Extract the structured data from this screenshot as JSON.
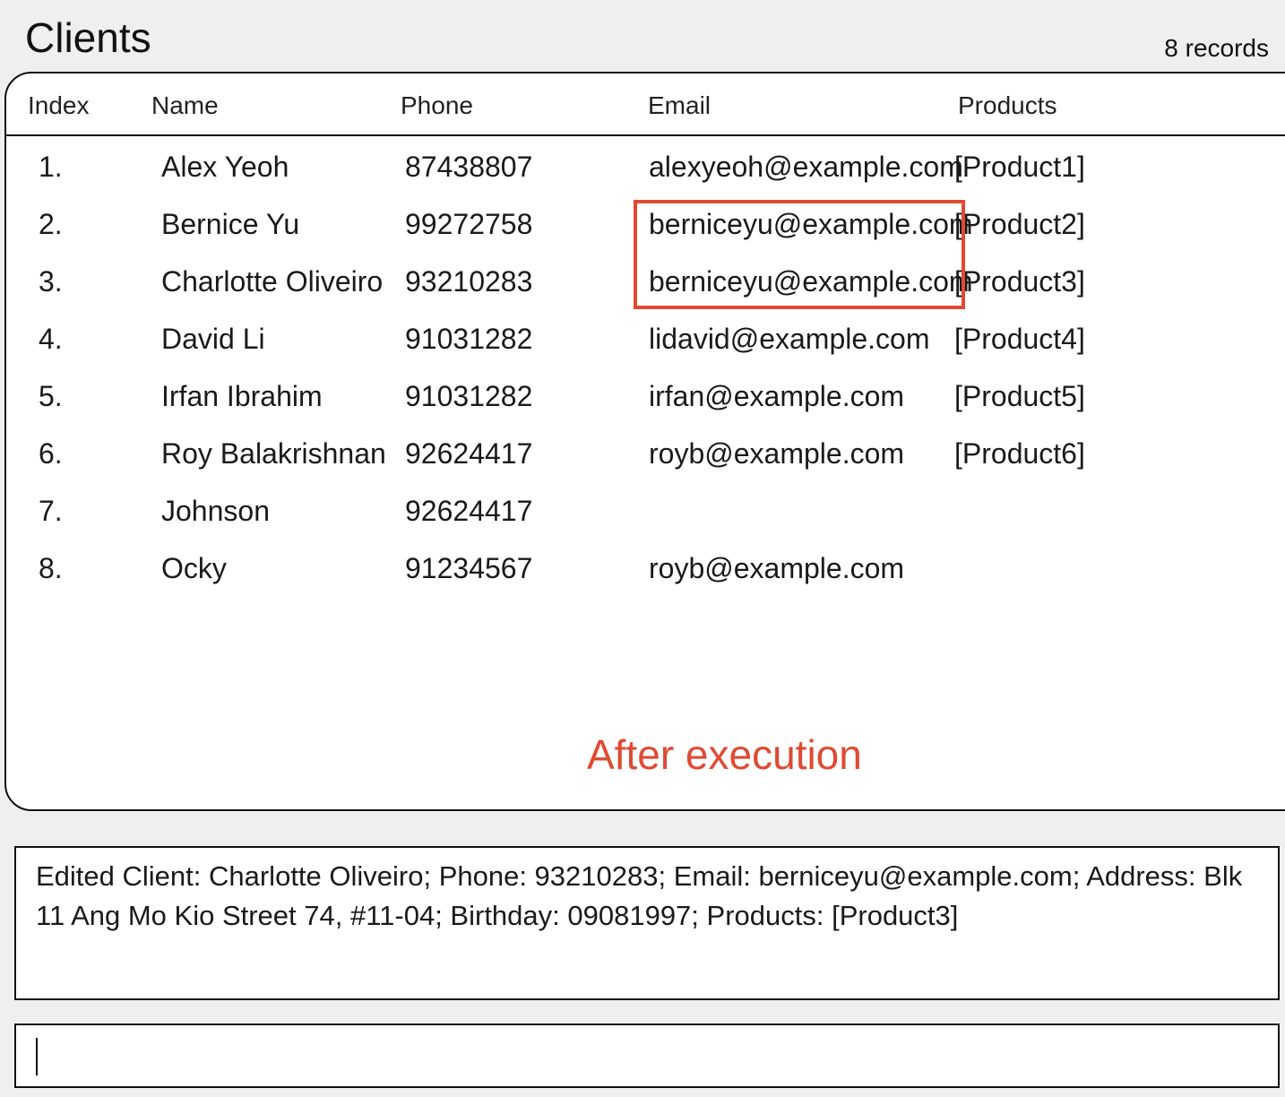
{
  "title": "Clients",
  "record_count": "8 records",
  "table": {
    "columns": [
      "Index",
      "Name",
      "Phone",
      "Email",
      "Products"
    ],
    "rows": [
      {
        "index": "1.",
        "name": "Alex Yeoh",
        "phone": "87438807",
        "email": "alexyeoh@example.com",
        "products": "[Product1]"
      },
      {
        "index": "2.",
        "name": "Bernice Yu",
        "phone": "99272758",
        "email": "berniceyu@example.com",
        "products": "[Product2]"
      },
      {
        "index": "3.",
        "name": "Charlotte Oliveiro",
        "phone": "93210283",
        "email": "berniceyu@example.com",
        "products": "[Product3]"
      },
      {
        "index": "4.",
        "name": "David Li",
        "phone": "91031282",
        "email": "lidavid@example.com",
        "products": "[Product4]"
      },
      {
        "index": "5.",
        "name": "Irfan Ibrahim",
        "phone": "91031282",
        "email": "irfan@example.com",
        "products": "[Product5]"
      },
      {
        "index": "6.",
        "name": "Roy Balakrishnan",
        "phone": "92624417",
        "email": "royb@example.com",
        "products": "[Product6]"
      },
      {
        "index": "7.",
        "name": "Johnson",
        "phone": "92624417",
        "email": "",
        "products": ""
      },
      {
        "index": "8.",
        "name": "Ocky",
        "phone": "91234567",
        "email": "royb@example.com",
        "products": ""
      }
    ]
  },
  "annotation": "After execution",
  "result_message": "Edited Client: Charlotte Oliveiro; Phone: 93210283; Email: berniceyu@example.com; Address: Blk 11 Ang Mo Kio Street 74, #11-04; Birthday: 09081997; Products: [Product3]",
  "command_input": {
    "value": ""
  },
  "colors": {
    "annotation": "#e04a32",
    "highlight": "#e04a32"
  }
}
